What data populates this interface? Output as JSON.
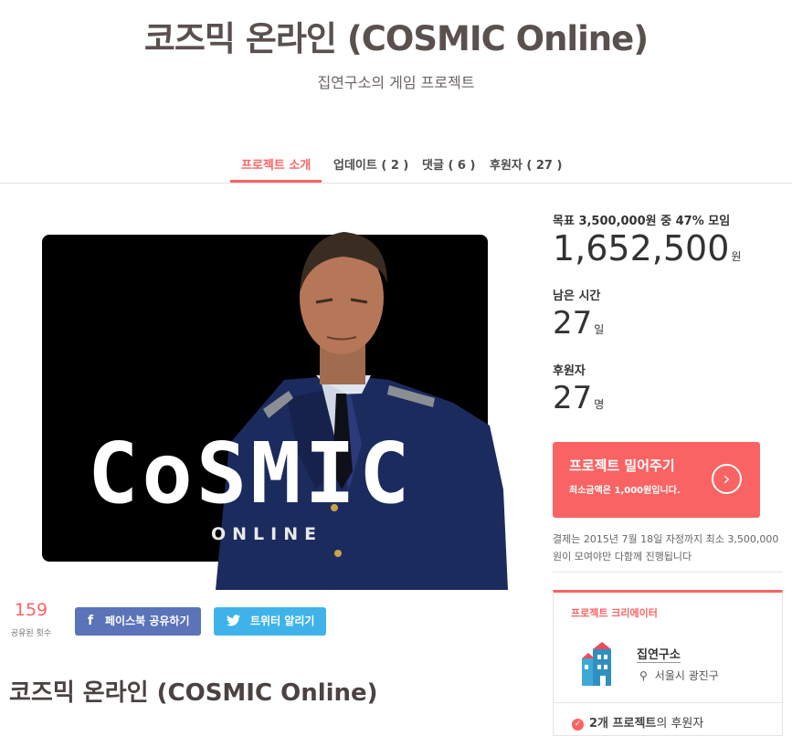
{
  "header": {
    "title": "코즈믹 온라인 (COSMIC Online)",
    "subtitle": "집연구소의 게임 프로젝트"
  },
  "tabs": [
    {
      "label": "프로젝트 소개",
      "active": true
    },
    {
      "label": "업데이트 ( 2 )",
      "active": false
    },
    {
      "label": "댓글 ( 6 )",
      "active": false
    },
    {
      "label": "후원자 ( 27 )",
      "active": false
    }
  ],
  "hero": {
    "logo_text": "CoSMIC",
    "logo_sub": "ONLINE"
  },
  "share": {
    "count": "159",
    "count_label": "공유된 횟수",
    "facebook_label": "페이스북 공유하기",
    "twitter_label": "트위터 알리기"
  },
  "project": {
    "title": "코즈믹 온라인 (COSMIC Online)"
  },
  "stats": {
    "goal_text": "목표 3,500,000원 중 47% 모임",
    "amount": "1,652,500",
    "amount_unit": "원",
    "time_label": "남은 시간",
    "days": "27",
    "days_unit": "일",
    "backers_label": "후원자",
    "backers": "27",
    "backers_unit": "명"
  },
  "support": {
    "title": "프로젝트 밀어주기",
    "subtitle": "최소금액은 1,000원입니다."
  },
  "notice": "결제는 2015년 7월 18일 자정까지 최소 3,500,000원이 모여야만 다함께 진행됩니다",
  "creator": {
    "heading": "프로젝트 크리에이터",
    "name": "집연구소",
    "location": "서울시 광진구",
    "backed_count": "2개 프로젝트",
    "backed_suffix": "의 후원자"
  },
  "colors": {
    "accent": "#fa6462",
    "facebook": "#5a73b9",
    "twitter": "#3fb3e9"
  }
}
